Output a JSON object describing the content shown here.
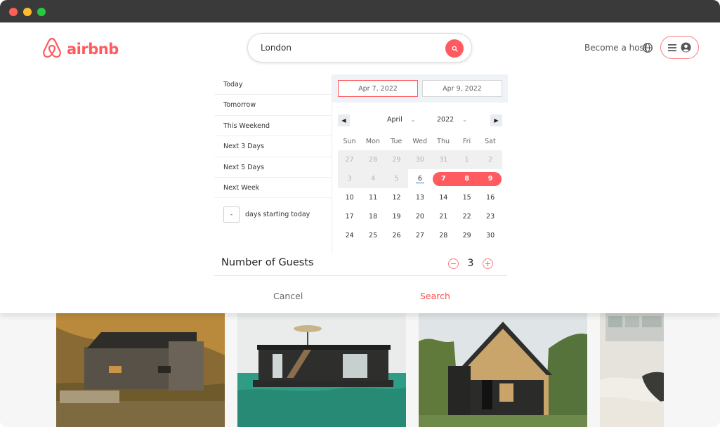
{
  "brand": {
    "name": "airbnb",
    "color": "#ff5a5f"
  },
  "search": {
    "query": "London",
    "icon": "search-icon"
  },
  "header": {
    "become_host": "Become a host",
    "globe_icon": "globe-icon",
    "menu_icon": "hamburger-icon",
    "user_icon": "user-circle-icon"
  },
  "presets": {
    "items": [
      "Today",
      "Tomorrow",
      "This Weekend",
      "Next 3 Days",
      "Next 5 Days",
      "Next Week"
    ],
    "days_input": "-",
    "days_label": "days starting today"
  },
  "calendar": {
    "start_date": "Apr 7, 2022",
    "end_date": "Apr 9, 2022",
    "month": "April",
    "year": "2022",
    "weekdays": [
      "Sun",
      "Mon",
      "Tue",
      "Wed",
      "Thu",
      "Fri",
      "Sat"
    ],
    "weeks": [
      [
        "27",
        "28",
        "29",
        "30",
        "31",
        "1",
        "2"
      ],
      [
        "3",
        "4",
        "5",
        "6",
        "7",
        "8",
        "9"
      ],
      [
        "10",
        "11",
        "12",
        "13",
        "14",
        "15",
        "16"
      ],
      [
        "17",
        "18",
        "19",
        "20",
        "21",
        "22",
        "23"
      ],
      [
        "24",
        "25",
        "26",
        "27",
        "28",
        "29",
        "30"
      ]
    ],
    "today": "6",
    "selected": [
      "7",
      "8",
      "9"
    ]
  },
  "guests": {
    "label": "Number of Guests",
    "count": "3",
    "minus": "−",
    "plus": "+"
  },
  "actions": {
    "cancel": "Cancel",
    "search": "Search"
  },
  "listings": [
    "listing-photo-coastal-house",
    "listing-photo-houseboat",
    "listing-photo-aframe-cabin",
    "listing-photo-bedroom"
  ]
}
